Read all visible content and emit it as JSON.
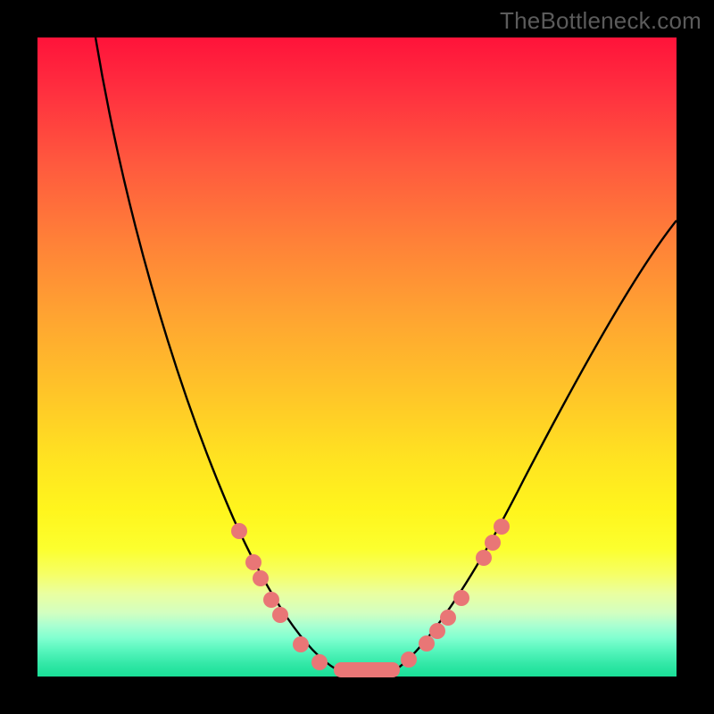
{
  "watermark": "TheBottleneck.com",
  "colors": {
    "frame_border": "#000000",
    "curve": "#000000",
    "markers": "#e97676",
    "gradient_top": "#ff133a",
    "gradient_bottom": "#19df97"
  },
  "chart_data": {
    "type": "line",
    "title": "",
    "xlabel": "",
    "ylabel": "",
    "xlim": [
      0,
      100
    ],
    "ylim": [
      0,
      100
    ],
    "grid": false,
    "legend": null,
    "series": [
      {
        "name": "bottleneck_curve",
        "x": [
          9,
          15,
          22,
          30,
          38,
          44,
          47,
          50,
          53,
          56,
          60,
          66,
          72,
          80,
          90,
          100
        ],
        "y": [
          100,
          75,
          52,
          32,
          15,
          5,
          1,
          1,
          1,
          1,
          6,
          16,
          30,
          48,
          62,
          72
        ]
      }
    ],
    "markers": {
      "name": "highlighted_points",
      "color": "#e97676",
      "left_branch": [
        {
          "x": 31,
          "y": 23
        },
        {
          "x": 33,
          "y": 18
        },
        {
          "x": 35,
          "y": 15
        },
        {
          "x": 36,
          "y": 12
        },
        {
          "x": 38,
          "y": 10
        },
        {
          "x": 41,
          "y": 5
        },
        {
          "x": 44,
          "y": 2
        }
      ],
      "floor": {
        "x_start": 46,
        "x_end": 57,
        "y": 1
      },
      "right_branch": [
        {
          "x": 58,
          "y": 3
        },
        {
          "x": 61,
          "y": 5
        },
        {
          "x": 63,
          "y": 7
        },
        {
          "x": 64,
          "y": 9
        },
        {
          "x": 66,
          "y": 12
        },
        {
          "x": 70,
          "y": 19
        },
        {
          "x": 71,
          "y": 21
        },
        {
          "x": 73,
          "y": 24
        }
      ]
    },
    "background_gradient": {
      "direction": "vertical",
      "stops": [
        {
          "pos": 0,
          "color": "#ff133a"
        },
        {
          "pos": 20,
          "color": "#ff5a3e"
        },
        {
          "pos": 44,
          "color": "#ffa531"
        },
        {
          "pos": 66,
          "color": "#ffe321"
        },
        {
          "pos": 84,
          "color": "#f6ff66"
        },
        {
          "pos": 92,
          "color": "#aaffd1"
        },
        {
          "pos": 100,
          "color": "#19df97"
        }
      ]
    }
  }
}
